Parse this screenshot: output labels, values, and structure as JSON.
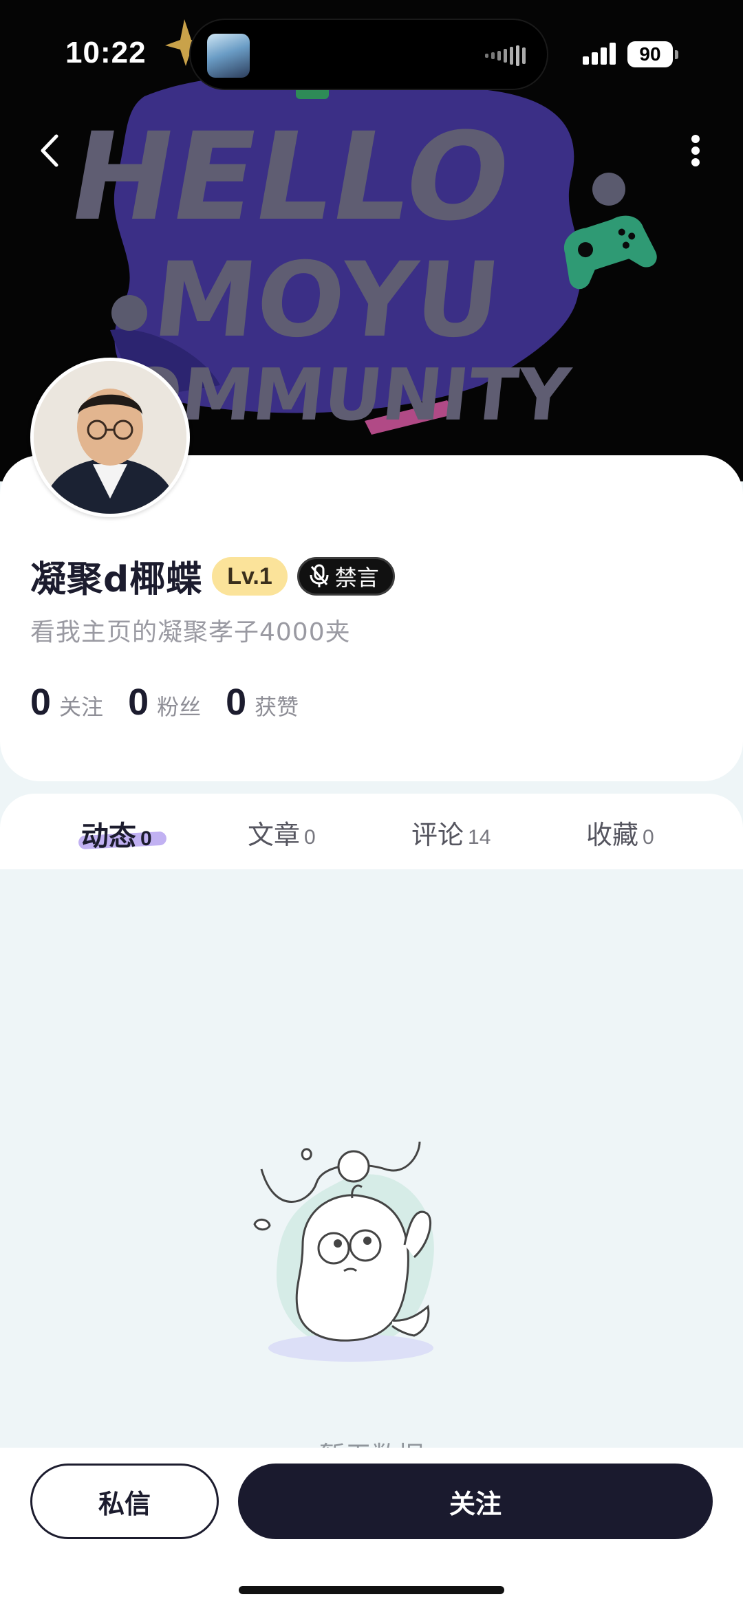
{
  "status_bar": {
    "time": "10:22",
    "battery": "90"
  },
  "banner": {
    "art_text": [
      "HELLO",
      "MOYU",
      "COMMUNITY"
    ]
  },
  "nav": {
    "back_icon": "chevron-left-icon",
    "more_icon": "more-vertical-icon"
  },
  "profile": {
    "name": "凝聚d椰蝶",
    "level": "Lv.1",
    "status_badge": "禁言",
    "bio": "看我主页的凝聚孝子4000夹",
    "stats": [
      {
        "value": "0",
        "label": "关注"
      },
      {
        "value": "0",
        "label": "粉丝"
      },
      {
        "value": "0",
        "label": "获赞"
      }
    ]
  },
  "tabs": [
    {
      "label": "动态",
      "count": "0",
      "active": true
    },
    {
      "label": "文章",
      "count": "0",
      "active": false
    },
    {
      "label": "评论",
      "count": "14",
      "active": false
    },
    {
      "label": "收藏",
      "count": "0",
      "active": false
    }
  ],
  "empty_state": {
    "text": "暂无数据"
  },
  "actions": {
    "message_label": "私信",
    "follow_label": "关注"
  },
  "colors": {
    "accent_dark": "#1a1a2e",
    "level_badge": "#fbe39a",
    "tab_underline": "#b6a3f0",
    "page_bg": "#eef5f7"
  }
}
